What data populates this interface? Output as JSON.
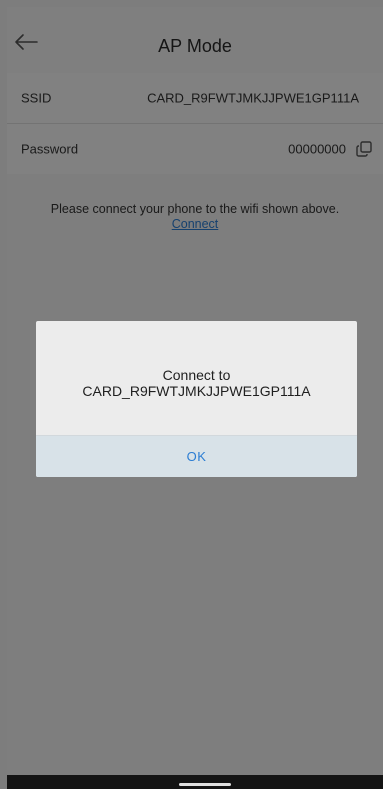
{
  "header": {
    "title": "AP Mode",
    "back_icon": "arrow-left-icon"
  },
  "ssid_row": {
    "label": "SSID",
    "value": "CARD_R9FWTJMKJJPWE1GP111A"
  },
  "password_row": {
    "label": "Password",
    "value": "00000000",
    "copy_icon": "copy-icon"
  },
  "hint": {
    "text": "Please connect your phone to the wifi shown above. ",
    "link": "Connect"
  },
  "dialog": {
    "message_line1": "Connect to",
    "message_line2": "CARD_R9FWTJMKJJPWE1GP111A",
    "ok_label": "OK"
  },
  "colors": {
    "accent": "#2b7dd3",
    "overlay": "#000000",
    "dialog_background": "#ececec",
    "ok_button_background": "#d8e2e8"
  }
}
